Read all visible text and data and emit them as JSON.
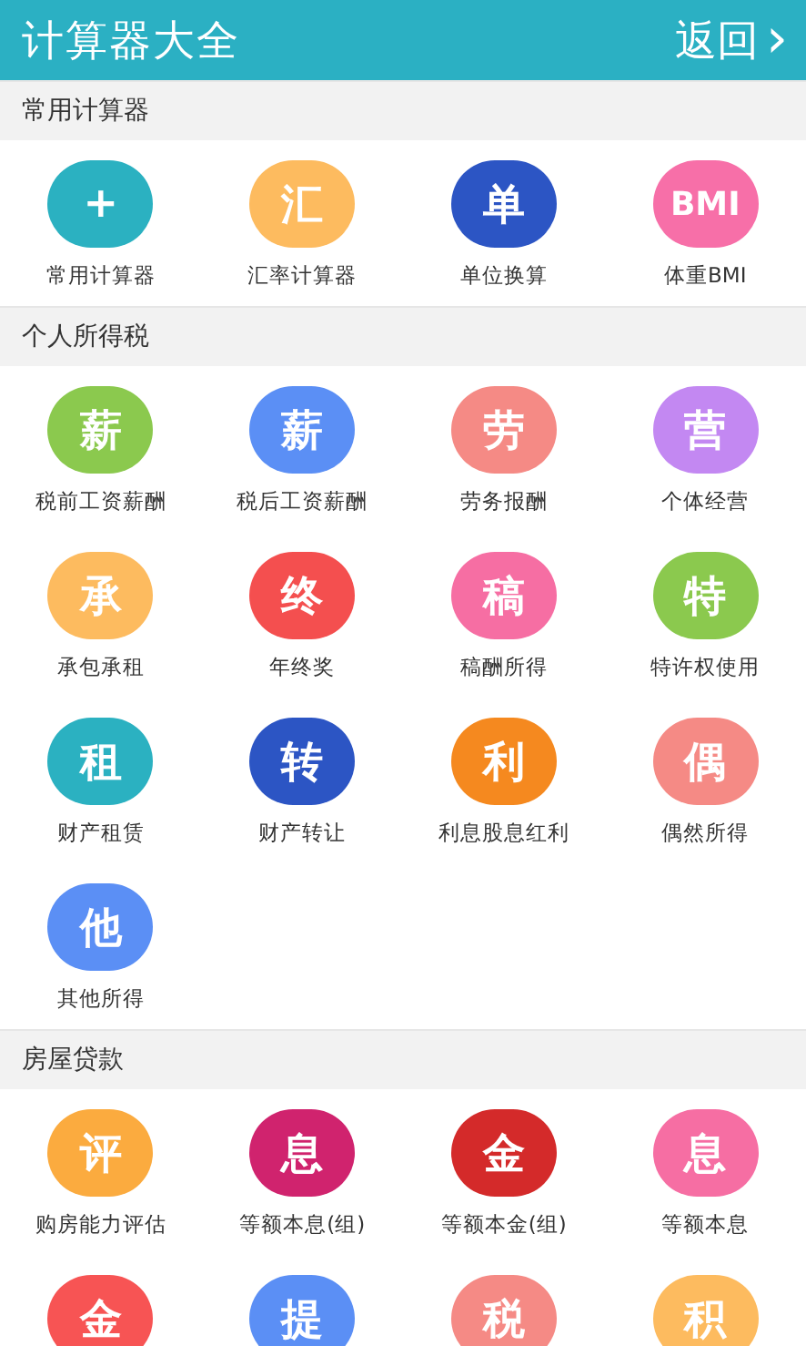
{
  "header": {
    "title": "计算器大全",
    "back": "返回",
    "back_icon": "›"
  },
  "sections": [
    {
      "title": "常用计算器",
      "items": [
        {
          "glyph": "+",
          "label": "常用计算器",
          "color": "#2bb1c1"
        },
        {
          "glyph": "汇",
          "label": "汇率计算器",
          "color": "#fdbb5f"
        },
        {
          "glyph": "单",
          "label": "单位换算",
          "color": "#2c55c4"
        },
        {
          "glyph": "BMI",
          "label": "体重BMI",
          "color": "#f76fa8"
        }
      ]
    },
    {
      "title": "个人所得税",
      "items": [
        {
          "glyph": "薪",
          "label": "税前工资薪酬",
          "color": "#8bc94e"
        },
        {
          "glyph": "薪",
          "label": "税后工资薪酬",
          "color": "#5b8ff5"
        },
        {
          "glyph": "劳",
          "label": "劳务报酬",
          "color": "#f58a85"
        },
        {
          "glyph": "营",
          "label": "个体经营",
          "color": "#c388f2"
        },
        {
          "glyph": "承",
          "label": "承包承租",
          "color": "#fdbb5f"
        },
        {
          "glyph": "终",
          "label": "年终奖",
          "color": "#f44f4f"
        },
        {
          "glyph": "稿",
          "label": "稿酬所得",
          "color": "#f66ea3"
        },
        {
          "glyph": "特",
          "label": "特许权使用",
          "color": "#8bc94e"
        },
        {
          "glyph": "租",
          "label": "财产租赁",
          "color": "#2bb1c1"
        },
        {
          "glyph": "转",
          "label": "财产转让",
          "color": "#2c55c4"
        },
        {
          "glyph": "利",
          "label": "利息股息红利",
          "color": "#f5891f"
        },
        {
          "glyph": "偶",
          "label": "偶然所得",
          "color": "#f58a85"
        },
        {
          "glyph": "他",
          "label": "其他所得",
          "color": "#5b8ff5"
        }
      ]
    },
    {
      "title": "房屋贷款",
      "items": [
        {
          "glyph": "评",
          "label": "购房能力评估",
          "color": "#fbab3f"
        },
        {
          "glyph": "息",
          "label": "等额本息(组)",
          "color": "#d0236e"
        },
        {
          "glyph": "金",
          "label": "等额本金(组)",
          "color": "#d42a2a"
        },
        {
          "glyph": "息",
          "label": "等额本息",
          "color": "#f66ea3"
        },
        {
          "glyph": "金",
          "color": "#f75454"
        },
        {
          "glyph": "提",
          "color": "#5b8ff5"
        },
        {
          "glyph": "税",
          "color": "#f58a85"
        },
        {
          "glyph": "积",
          "color": "#fdbb5f"
        }
      ]
    }
  ]
}
